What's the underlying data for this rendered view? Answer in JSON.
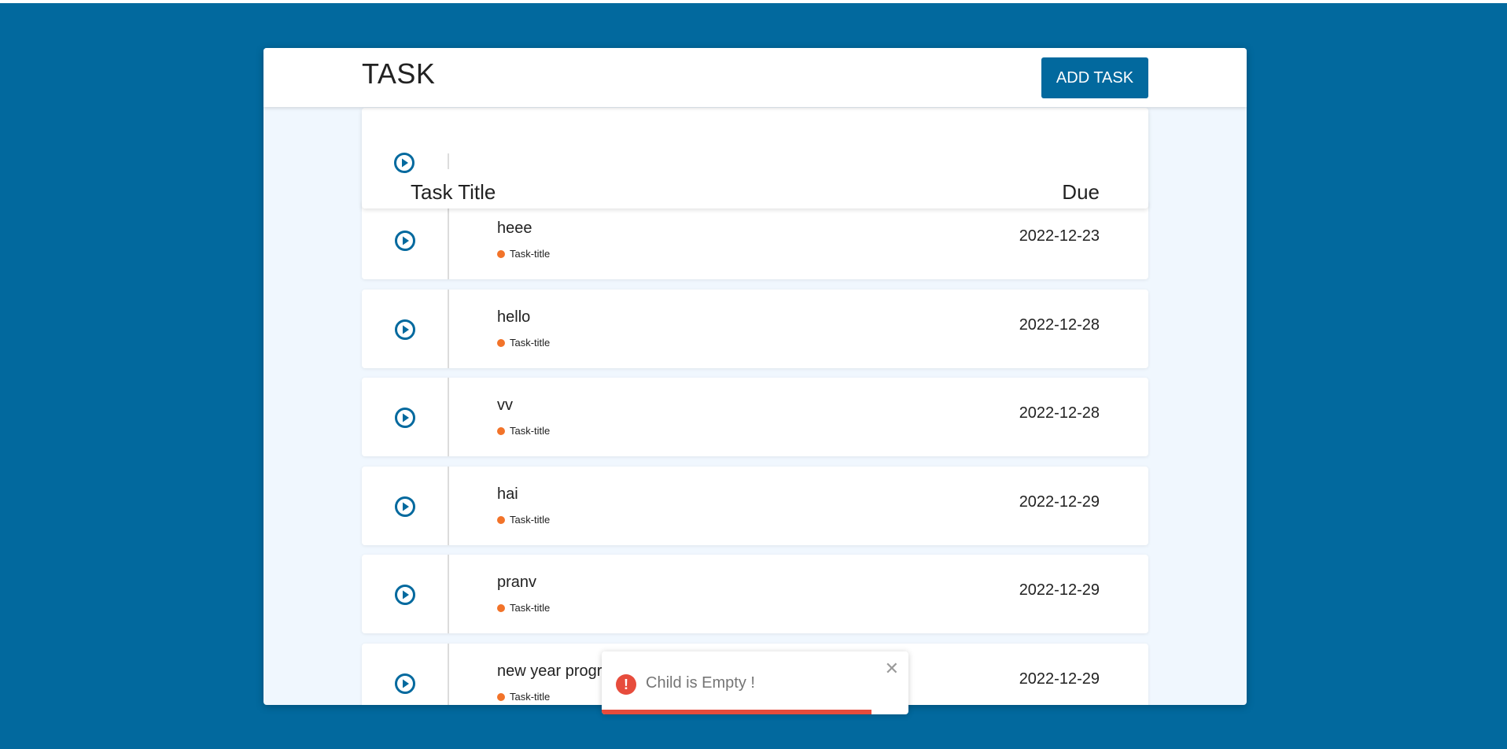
{
  "header": {
    "title": "TASK",
    "add_label": "ADD TASK"
  },
  "columns": {
    "title": "Task Title",
    "due": "Due"
  },
  "tasks": [
    {
      "name": "heee",
      "tag": "Task-title",
      "due": "2022-12-23"
    },
    {
      "name": "hello",
      "tag": "Task-title",
      "due": "2022-12-28"
    },
    {
      "name": "vv",
      "tag": "Task-title",
      "due": "2022-12-28"
    },
    {
      "name": "hai",
      "tag": "Task-title",
      "due": "2022-12-29"
    },
    {
      "name": "pranv",
      "tag": "Task-title",
      "due": "2022-12-29"
    },
    {
      "name": "new year program",
      "tag": "Task-title",
      "due": "2022-12-29"
    }
  ],
  "toast": {
    "message": "Child is Empty !",
    "icon": "error-icon",
    "close_icon": "close-icon",
    "progress": 0.88
  },
  "colors": {
    "brand": "#02699e",
    "panel": "#f0f7fe",
    "tag_dot": "#f27329",
    "error": "#e74c3c"
  },
  "icons": {
    "row_action": "play-circle-icon"
  }
}
